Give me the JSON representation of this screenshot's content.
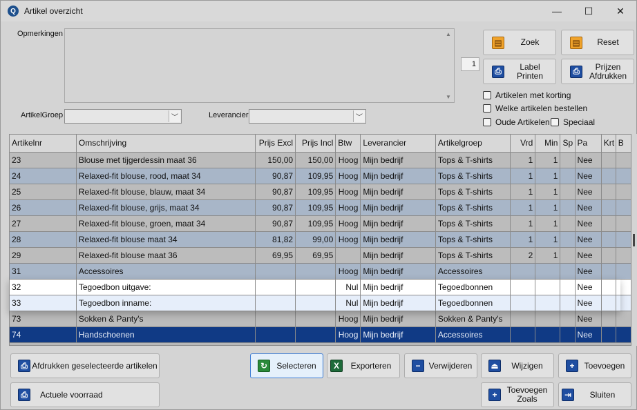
{
  "window": {
    "title": "Artikel overzicht",
    "minimize": "—",
    "maximize": "☐",
    "close": "✕"
  },
  "form": {
    "opmerkingen_label": "Opmerkingen",
    "opmerkingen_value": "",
    "artikelgroep_label": "ArtikelGroep",
    "artikelgroep_value": "",
    "leverancier_label": "Leverancier",
    "leverancier_value": "",
    "page_number": "1"
  },
  "buttons": {
    "zoek": "Zoek",
    "reset": "Reset",
    "label_printen": "Label\nPrinten",
    "prijzen_afdrukken": "Prijzen\nAfdrukken",
    "afdrukken_geselecteerde": "Afdrukken geselecteerde artikelen",
    "actuele_voorraad": "Actuele voorraad",
    "selecteren": "Selecteren",
    "exporteren": "Exporteren",
    "verwijderen": "Verwijderen",
    "wijzigen": "Wijzigen",
    "toevoegen": "Toevoegen",
    "toevoegen_zoals": "Toevoegen\nZoals",
    "sluiten": "Sluiten"
  },
  "checkboxes": {
    "artikelen_met_korting": "Artikelen met korting",
    "welke_artikelen_bestellen": "Welke artikelen bestellen",
    "oude_artikelen": "Oude Artikelen",
    "speciaal": "Speciaal"
  },
  "table": {
    "columns": [
      "Artikelnr",
      "Omschrijving",
      "Prijs Excl",
      "Prijs Incl",
      "Btw",
      "Leverancier",
      "Artikelgroep",
      "Vrd",
      "Min",
      "Sp",
      "Pa",
      "Krt",
      "B"
    ],
    "rows": [
      {
        "style": "c-gray",
        "cells": [
          "23",
          "Blouse met tijgerdessin maat 36",
          "150,00",
          "150,00",
          "Hoog",
          "Mijn bedrijf",
          "Tops & T-shirts",
          "1",
          "1",
          "",
          "Nee",
          "",
          ""
        ]
      },
      {
        "style": "c-blue",
        "cells": [
          "24",
          "Relaxed-fit blouse, rood, maat 34",
          "90,87",
          "109,95",
          "Hoog",
          "Mijn bedrijf",
          "Tops & T-shirts",
          "1",
          "1",
          "",
          "Nee",
          "",
          ""
        ]
      },
      {
        "style": "c-gray",
        "cells": [
          "25",
          "Relaxed-fit blouse, blauw, maat 34",
          "90,87",
          "109,95",
          "Hoog",
          "Mijn bedrijf",
          "Tops & T-shirts",
          "1",
          "1",
          "",
          "Nee",
          "",
          ""
        ]
      },
      {
        "style": "c-blue",
        "cells": [
          "26",
          "Relaxed-fit blouse, grijs, maat 34",
          "90,87",
          "109,95",
          "Hoog",
          "Mijn bedrijf",
          "Tops & T-shirts",
          "1",
          "1",
          "",
          "Nee",
          "",
          ""
        ]
      },
      {
        "style": "c-gray",
        "cells": [
          "27",
          "Relaxed-fit blouse, groen, maat 34",
          "90,87",
          "109,95",
          "Hoog",
          "Mijn bedrijf",
          "Tops & T-shirts",
          "1",
          "1",
          "",
          "Nee",
          "",
          ""
        ]
      },
      {
        "style": "c-blue",
        "cells": [
          "28",
          "Relaxed-fit blouse maat 34",
          "81,82",
          "99,00",
          "Hoog",
          "Mijn bedrijf",
          "Tops & T-shirts",
          "1",
          "1",
          "",
          "Nee",
          "",
          ""
        ]
      },
      {
        "style": "c-gray",
        "cells": [
          "29",
          "Relaxed-fit blouse maat 36",
          "69,95",
          "69,95",
          "",
          "Mijn bedrijf",
          "Tops & T-shirts",
          "2",
          "1",
          "",
          "Nee",
          "",
          ""
        ]
      },
      {
        "style": "c-blue",
        "cells": [
          "31",
          "Accessoires",
          "",
          "",
          "Hoog",
          "Mijn bedrijf",
          "Accessoires",
          "",
          "",
          "",
          "Nee",
          "",
          ""
        ]
      },
      {
        "style": "c-white",
        "cells": [
          "32",
          "Tegoedbon uitgave:",
          "",
          "",
          "Nul",
          "Mijn bedrijf",
          "Tegoedbonnen",
          "",
          "",
          "",
          "Nee",
          "",
          ""
        ]
      },
      {
        "style": "c-light",
        "cells": [
          "33",
          "Tegoedbon inname:",
          "",
          "",
          "Nul",
          "Mijn bedrijf",
          "Tegoedbonnen",
          "",
          "",
          "",
          "Nee",
          "",
          ""
        ]
      },
      {
        "style": "c-gray",
        "cells": [
          "73",
          "Sokken & Panty's",
          "",
          "",
          "Hoog",
          "Mijn bedrijf",
          "Sokken & Panty's",
          "",
          "",
          "",
          "Nee",
          "",
          ""
        ]
      },
      {
        "style": "c-sel",
        "cells": [
          "74",
          "Handschoenen",
          "",
          "",
          "Hoog",
          "Mijn bedrijf",
          "Accessoires",
          "",
          "",
          "",
          "Nee",
          "",
          ""
        ]
      }
    ]
  }
}
